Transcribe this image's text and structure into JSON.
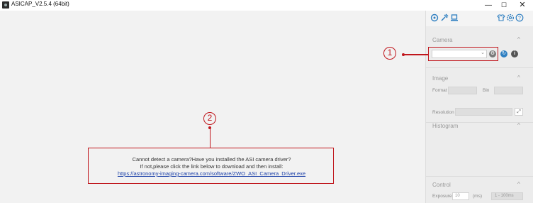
{
  "window": {
    "title": "ASICAP_V2.5.4 (64bit)",
    "minimize_icon": "—",
    "maximize_icon": "☐",
    "close_icon": "✕"
  },
  "toolbar": {
    "icons": [
      "usb-hub-icon",
      "tools-icon",
      "laptop-icon",
      "shirt-icon",
      "settings-icon",
      "help-icon"
    ]
  },
  "camera": {
    "title": "Camera",
    "select_value": "",
    "chevron": "^"
  },
  "image": {
    "title": "Image",
    "chevron": "^",
    "format_label": "Format",
    "bin_label": "Bin",
    "resolution_label": "Resolution"
  },
  "histogram": {
    "title": "Histogram",
    "chevron": "^"
  },
  "control": {
    "title": "Control",
    "chevron": "^",
    "exposure_label": "Exposure",
    "exposure_value": "10",
    "exposure_unit": "(ms)",
    "exposure_range": "1 - 100ms"
  },
  "message": {
    "line1": "Cannot detect a camera?Have you installed the ASI camera driver?",
    "line2": "If not,please click the link below to download and then install:",
    "link": "https://astronomy-imaging-camera.com/software/ZWO_ASI_Camera_Driver.exe"
  },
  "callouts": {
    "marker1": "1",
    "marker2": "2"
  },
  "colors": {
    "accent": "#2f7fc1",
    "callout": "#c0161c",
    "link": "#1a3fa8"
  }
}
